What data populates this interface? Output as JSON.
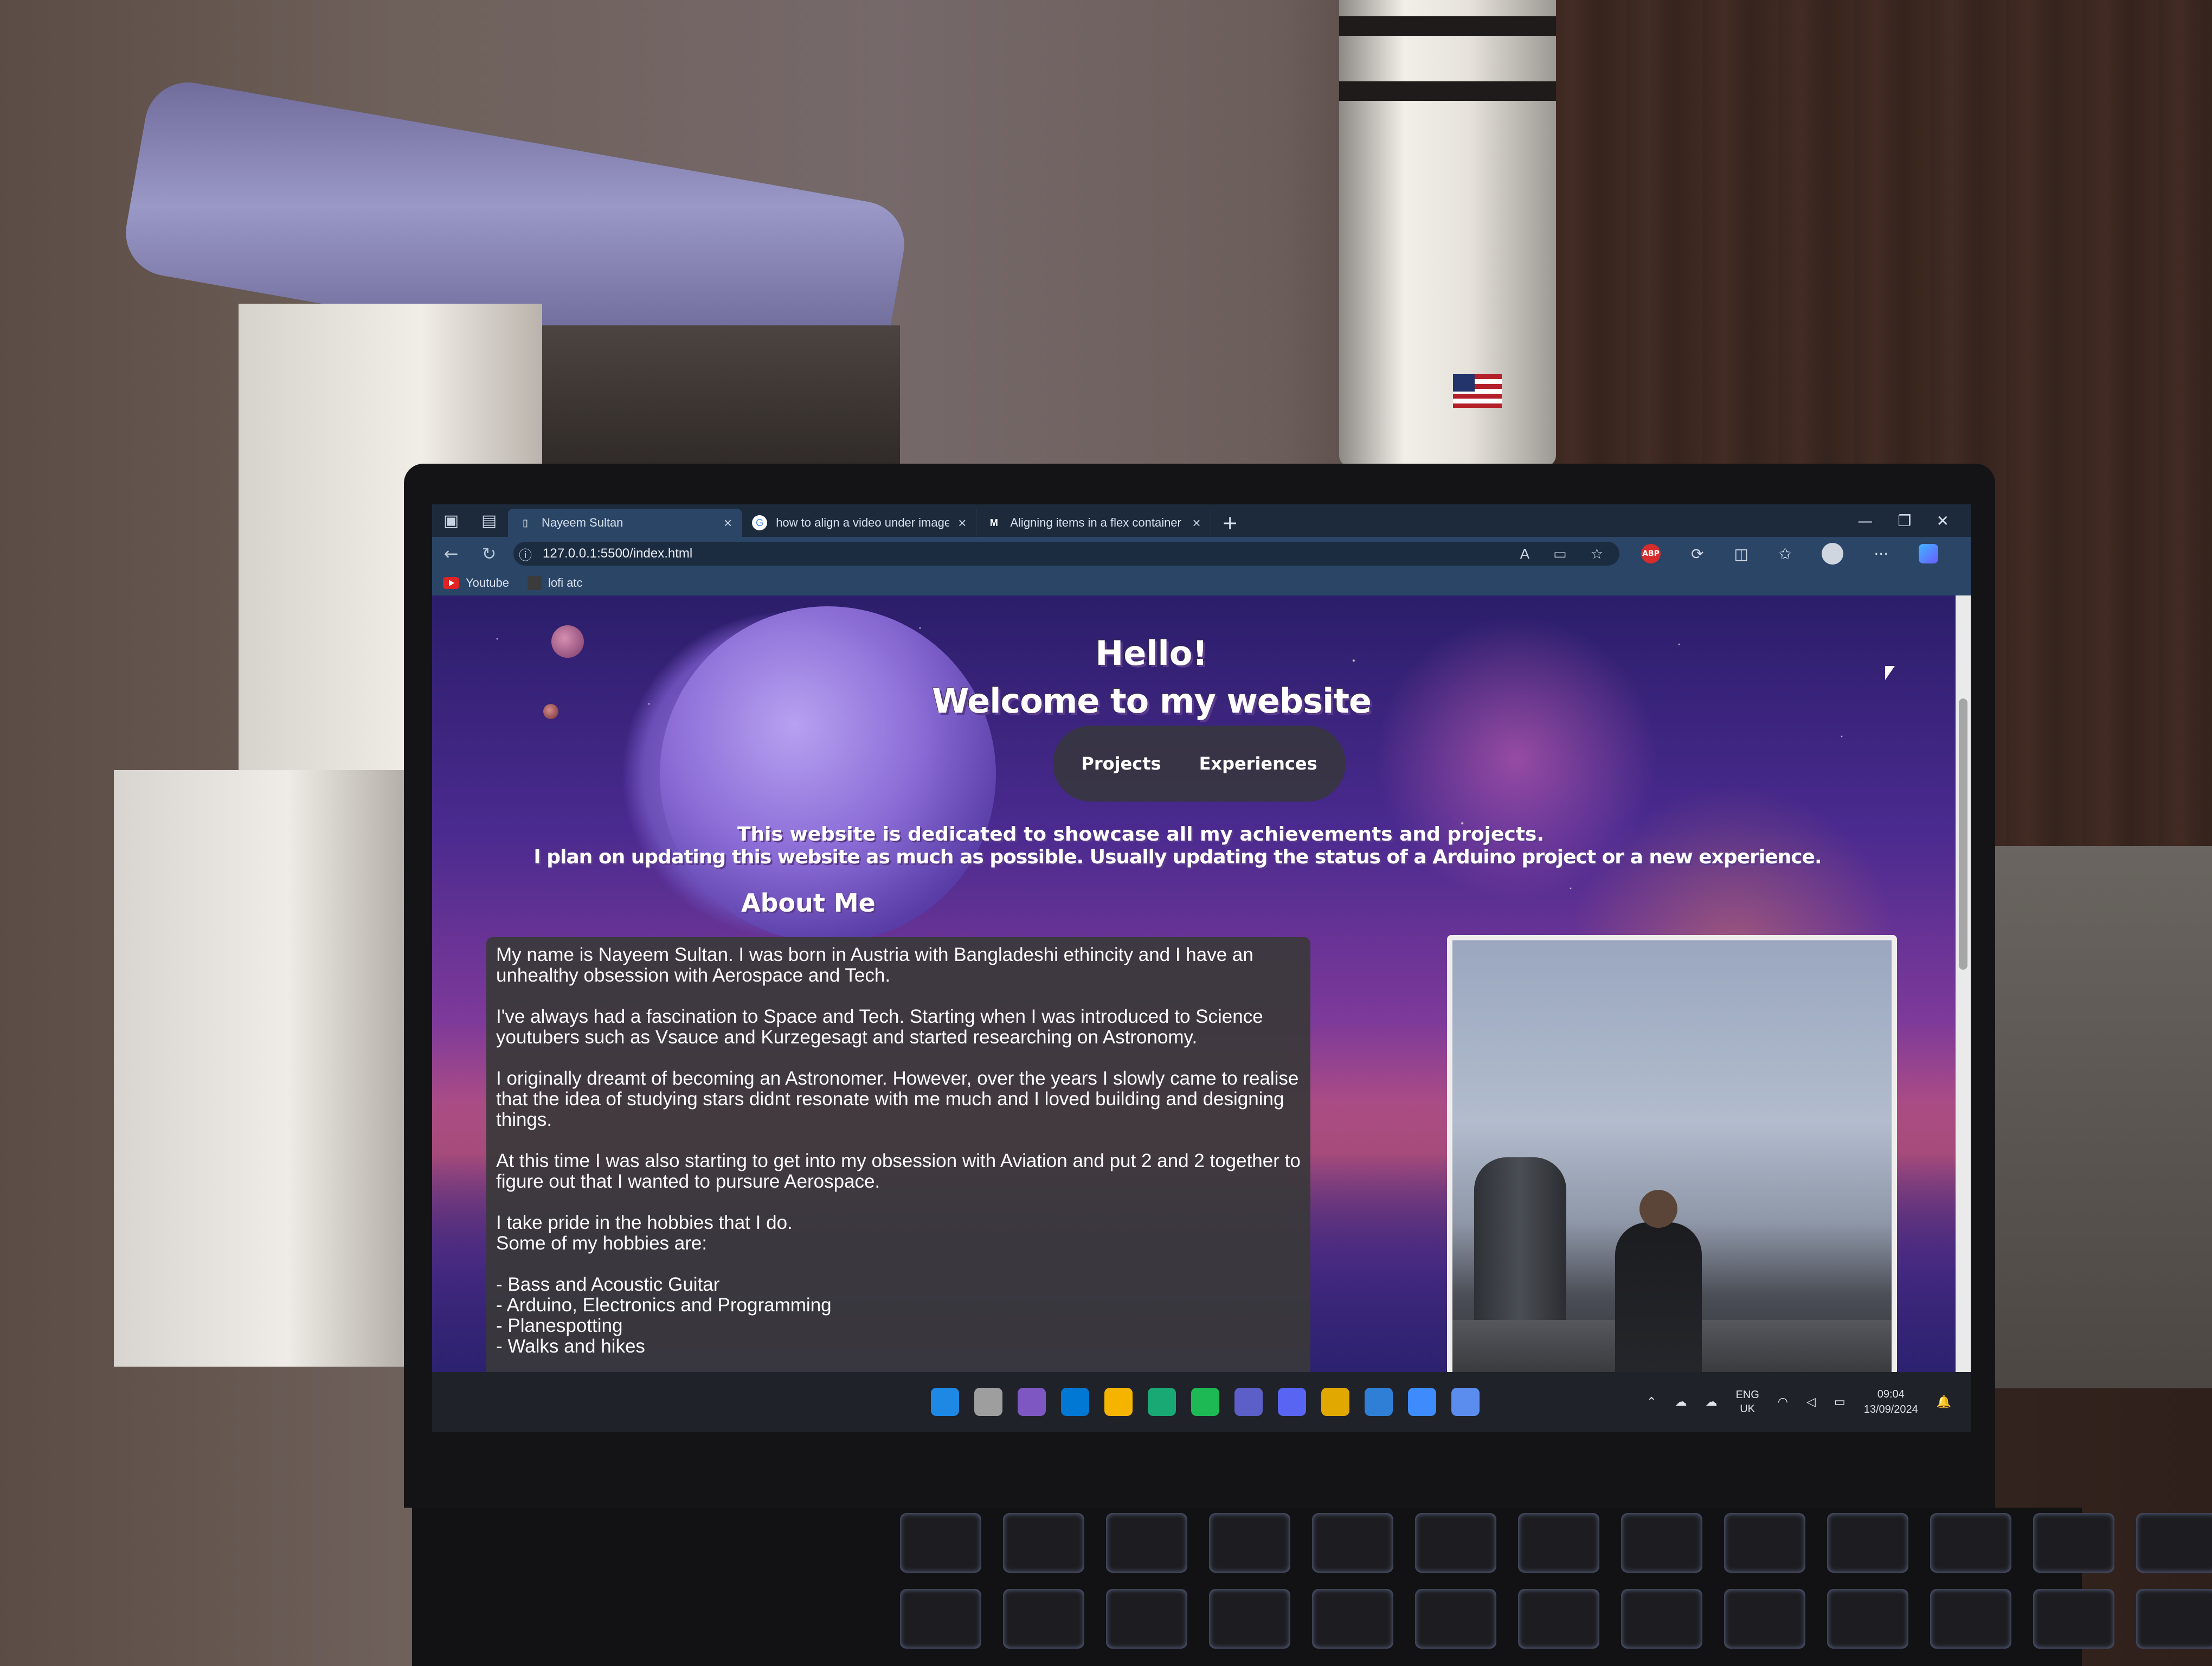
{
  "browser": {
    "tabs": [
      {
        "title": "Nayeem Sultan",
        "favicon": "page-icon",
        "active": true
      },
      {
        "title": "how to align a video under image",
        "favicon": "google-icon",
        "active": false
      },
      {
        "title": "Aligning items in a flex container",
        "favicon": "mdn-icon",
        "active": false
      }
    ],
    "url": "127.0.0.1:5500/index.html",
    "bookmarks": [
      {
        "label": "Youtube",
        "icon": "youtube-icon"
      },
      {
        "label": "lofi atc",
        "icon": "lofi-icon"
      }
    ]
  },
  "page": {
    "hello": "Hello!",
    "welcome": "Welcome to my website",
    "nav": {
      "projects": "Projects",
      "experiences": "Experiences"
    },
    "tagline_1": "This website is dedicated to showcase all my achievements and projects.",
    "tagline_2": "I plan on updating this website as much as possible. Usually updating the status of a Arduino project or a new experience.",
    "about_title": "About Me",
    "about": {
      "p1": "My name is Nayeem Sultan. I was born in Austria with Bangladeshi ethincity and I have an unhealthy obsession with Aerospace and Tech.",
      "p2": "I've always had a fascination to Space and Tech. Starting when I was introduced to Science youtubers such as Vsauce and Kurzegesagt and started researching on Astronomy.",
      "p3": "I originally dreamt of becoming an Astronomer. However, over the years I slowly came to realise that the idea of studying stars didnt resonate with me much and I loved building and designing things.",
      "p4": "At this time I was also starting to get into my obsession with Aviation and put 2 and 2 together to figure out that I wanted to pursure Aerospace.",
      "p5a": "I take pride in the hobbies that I do.",
      "p5b": "Some of my hobbies are:",
      "hobbies": [
        "- Bass and Acoustic Guitar",
        "- Arduino, Electronics and Programming",
        "- Planespotting",
        "- Walks and hikes"
      ]
    }
  },
  "taskbar": {
    "language": "ENG",
    "region": "UK",
    "time": "09:04",
    "date": "13/09/2024",
    "app_colors": [
      "#1e88e5",
      "#9e9e9e",
      "#7e57c2",
      "#0078d4",
      "#f4b400",
      "#19a974",
      "#1db954",
      "#5b5fc7",
      "#5865f2",
      "#e0a800",
      "#2f7fd6",
      "#3d8bfd",
      "#5b8def"
    ]
  }
}
